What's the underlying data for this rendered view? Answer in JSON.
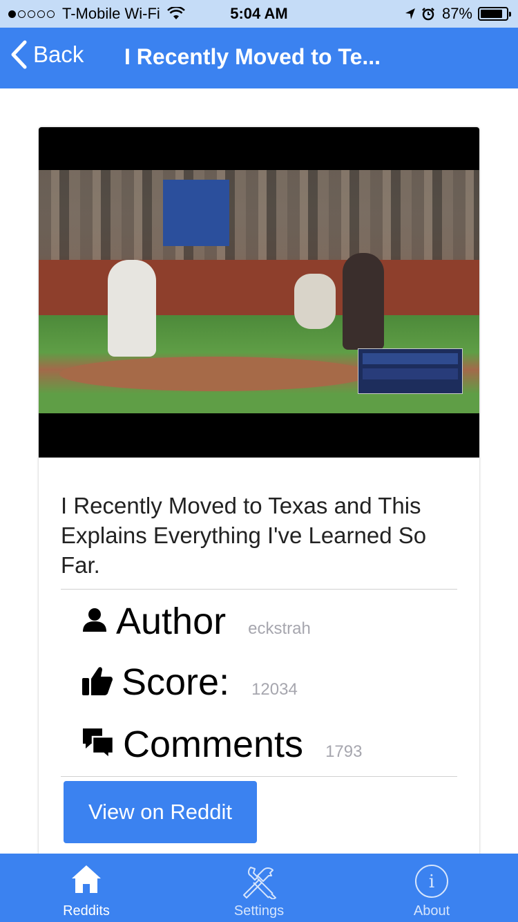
{
  "status_bar": {
    "carrier": "T-Mobile Wi-Fi",
    "time": "5:04 AM",
    "battery": "87%",
    "battery_level": 0.87,
    "signal_bars": 1
  },
  "nav": {
    "back_label": "Back",
    "title": "I Recently Moved to Te..."
  },
  "post": {
    "title": "I Recently Moved to Texas and This Explains Everything I've Learned So Far.",
    "author_label": "Author",
    "author": "eckstrah",
    "score_label": "Score:",
    "score": "12034",
    "comments_label": "Comments",
    "comments": "1793",
    "view_button": "View on Reddit"
  },
  "tabs": [
    {
      "label": "Reddits",
      "icon": "home-icon",
      "active": true
    },
    {
      "label": "Settings",
      "icon": "tools-icon",
      "active": false
    },
    {
      "label": "About",
      "icon": "info-icon",
      "active": false
    }
  ],
  "colors": {
    "accent": "#3b82f0",
    "status_bar": "#c5dcf7",
    "meta_value": "#a6a6ae"
  }
}
